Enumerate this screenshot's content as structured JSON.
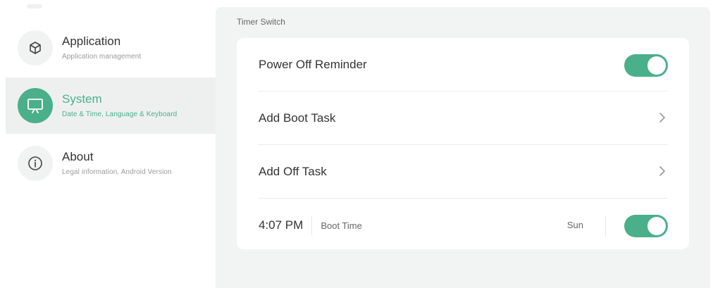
{
  "sidebar": {
    "items": [
      {
        "title": "Application",
        "subtitle": "Application management",
        "icon": "cube-icon",
        "active": false
      },
      {
        "title": "System",
        "subtitle": "Date & Time, Language & Keyboard",
        "icon": "monitor-icon",
        "active": true
      },
      {
        "title": "About",
        "subtitle": "Legal information, Android Version",
        "icon": "info-icon",
        "active": false
      }
    ]
  },
  "main": {
    "section_title": "Timer Switch",
    "rows": [
      {
        "label": "Power Off Reminder",
        "control": "toggle",
        "on": true
      },
      {
        "label": "Add Boot Task",
        "control": "chevron"
      },
      {
        "label": "Add Off Task",
        "control": "chevron"
      }
    ],
    "task": {
      "time": "4:07 PM",
      "type": "Boot Time",
      "days": "Sun",
      "on": true
    }
  },
  "colors": {
    "accent": "#4aaf8b",
    "panel_bg": "#f2f3f3",
    "card_bg": "#ffffff"
  }
}
